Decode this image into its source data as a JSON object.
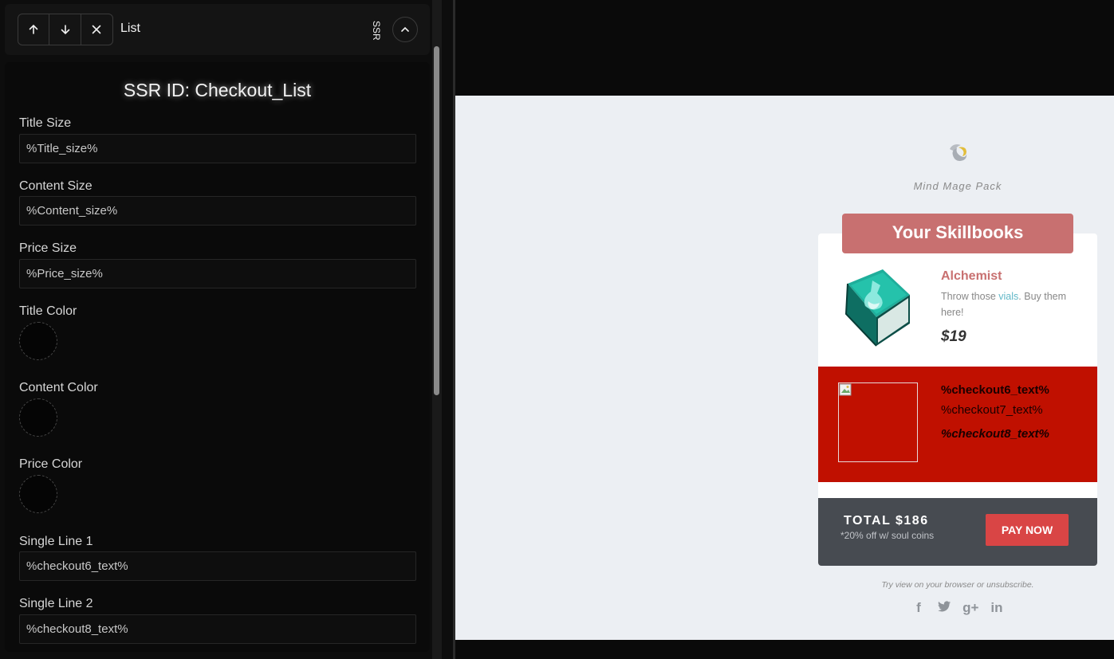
{
  "toolbar": {
    "title": "List",
    "ssr_label": "SSR",
    "icons": [
      "arrow-up-icon",
      "arrow-down-icon",
      "close-icon",
      "chevron-up-icon"
    ]
  },
  "form": {
    "ssr_id": "SSR ID: Checkout_List",
    "fields": [
      {
        "label": "Title Size",
        "value": "%Title_size%"
      },
      {
        "label": "Content Size",
        "value": "%Content_size%"
      },
      {
        "label": "Price Size",
        "value": "%Price_size%"
      },
      {
        "label": "Single Line 1",
        "value": "%checkout6_text%"
      },
      {
        "label": "Single Line 2",
        "value": "%checkout8_text%"
      }
    ],
    "colors": [
      {
        "label": "Title Color",
        "value": "#050505"
      },
      {
        "label": "Content Color",
        "value": "#050505"
      },
      {
        "label": "Price Color",
        "value": "#050505"
      }
    ]
  },
  "preview": {
    "brand": "Mind Mage Pack",
    "header": "Your Skillbooks",
    "item1": {
      "title": "Alchemist",
      "desc_before": "Throw those ",
      "desc_link": "vials",
      "desc_after": ". Buy them here!",
      "price": "$19"
    },
    "item2": {
      "title": "%checkout6_text%",
      "desc": "%checkout7_text%",
      "price": "%checkout8_text%"
    },
    "total": {
      "label": "TOTAL $186",
      "note": "*20% off w/ soul coins",
      "button": "PAY NOW"
    },
    "footer_note": "Try view on your browser or unsubscribe.",
    "social": [
      "f",
      "t",
      "g+",
      "in"
    ],
    "social_icons": [
      "facebook-icon",
      "twitter-icon",
      "google-plus-icon",
      "linkedin-icon"
    ]
  },
  "colors": {
    "accent": "#c87070",
    "item2_bg": "#c01000",
    "pay_button": "#d94545",
    "total_bar": "#474b51",
    "link": "#62b8c8"
  }
}
